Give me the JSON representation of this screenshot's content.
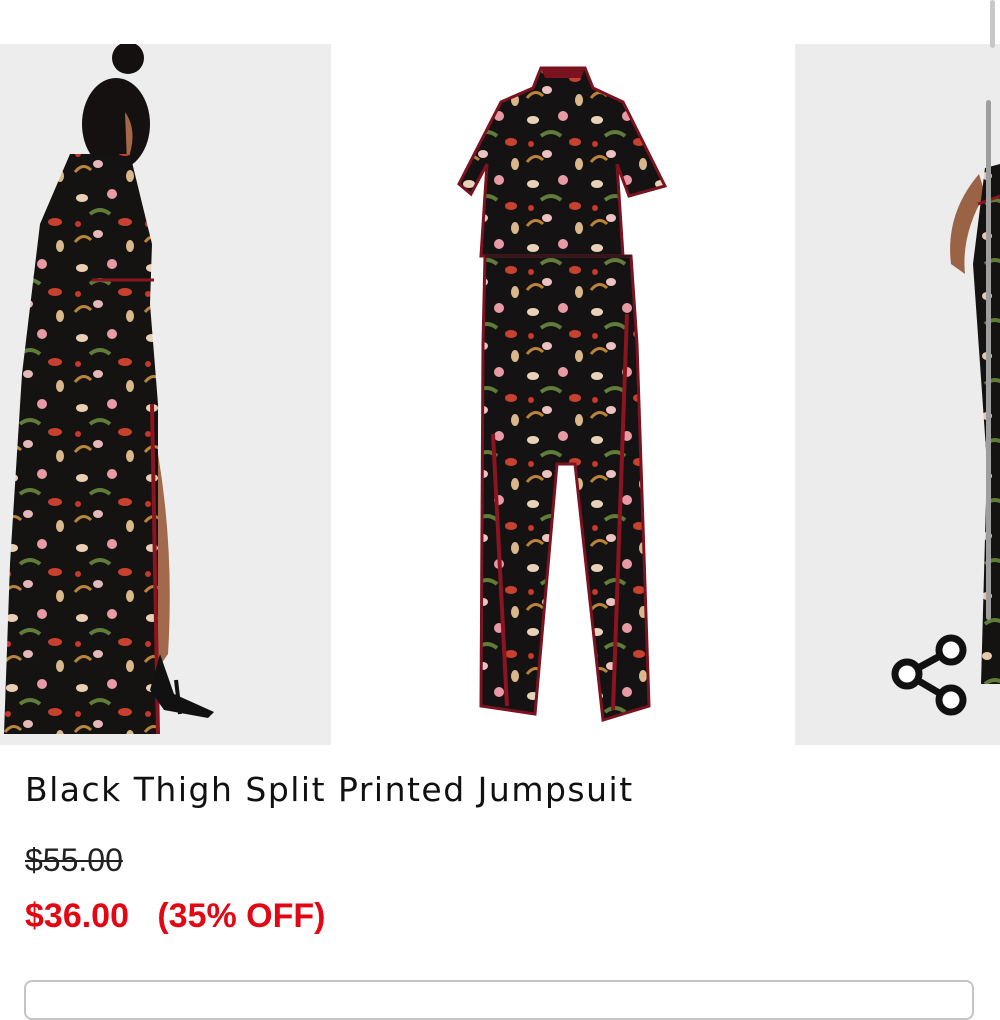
{
  "product": {
    "title": "Black Thigh Split Printed Jumpsuit",
    "original_price": "$55.00",
    "sale_price": "$36.00",
    "discount": "(35% OFF)"
  },
  "gallery": {
    "images": [
      "model-back-view",
      "flat-lay-front",
      "model-side-view"
    ]
  },
  "icons": {
    "share": "share-icon"
  },
  "colors": {
    "sale": "#e30613",
    "text": "#111111",
    "fabric": "#141212",
    "trim": "#8a1420"
  }
}
